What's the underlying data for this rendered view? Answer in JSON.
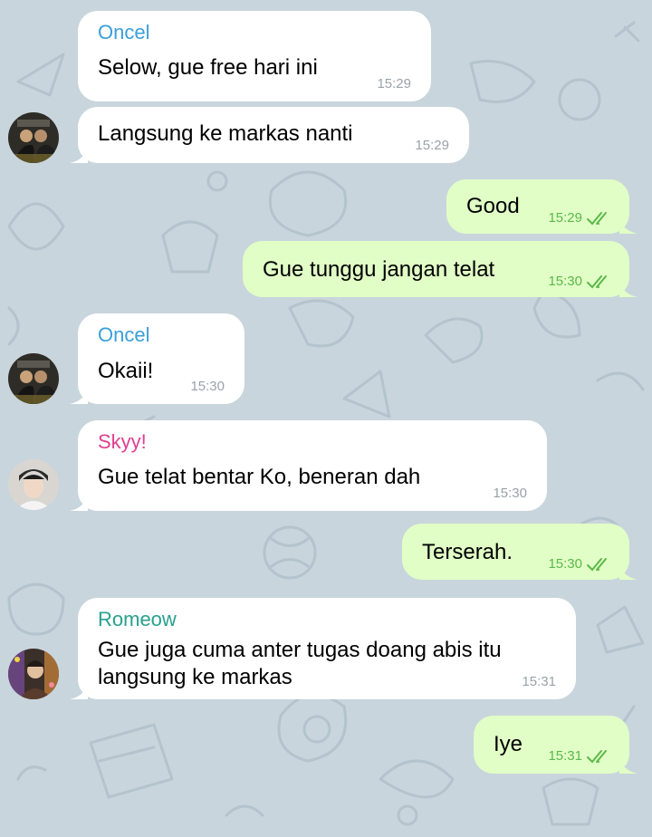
{
  "colors": {
    "wallpaper": "#c9d5dd",
    "incoming_bubble": "#ffffff",
    "outgoing_bubble": "#e1fec6",
    "outgoing_time": "#5bb84a",
    "incoming_time": "#9aa2a8",
    "name_oncel": "#3a9fd8",
    "name_skyy": "#e0408f",
    "name_romeow": "#28a08e"
  },
  "messages": [
    {
      "direction": "in",
      "sender": "Oncel",
      "text": "Selow, gue free hari ini",
      "time": "15:29"
    },
    {
      "direction": "in",
      "sender": "",
      "text": "Langsung ke markas nanti",
      "time": "15:29",
      "avatar": "avatar-oncel"
    },
    {
      "direction": "out",
      "text": "Good",
      "time": "15:29",
      "status": "double-check-icon"
    },
    {
      "direction": "out",
      "text": "Gue tunggu jangan telat",
      "time": "15:30",
      "status": "double-check-icon"
    },
    {
      "direction": "in",
      "sender": "Oncel",
      "text": "Okaii!",
      "time": "15:30",
      "avatar": "avatar-oncel"
    },
    {
      "direction": "in",
      "sender": "Skyy!",
      "text": "Gue telat bentar Ko, beneran dah",
      "time": "15:30",
      "avatar": "avatar-skyy"
    },
    {
      "direction": "out",
      "text": "Terserah.",
      "time": "15:30",
      "status": "double-check-icon"
    },
    {
      "direction": "in",
      "sender": "Romeow",
      "text_line1": "Gue juga cuma anter tugas doang abis itu",
      "text_line2": "langsung ke markas",
      "time": "15:31",
      "avatar": "avatar-romeow"
    },
    {
      "direction": "out",
      "text": "Iye",
      "time": "15:31",
      "status": "double-check-icon"
    }
  ]
}
